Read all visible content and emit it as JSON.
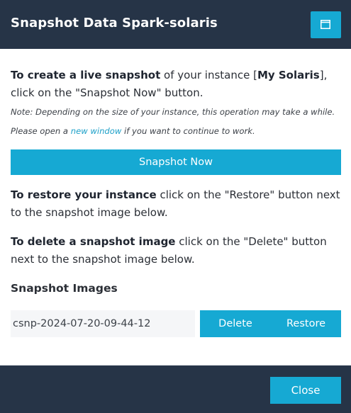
{
  "header": {
    "title": "Snapshot Data Spark-solaris",
    "window_icon": "window-icon"
  },
  "intro": {
    "bold1": "To create a live snapshot",
    "text1": " of your instance [",
    "instance_name": "My Solaris",
    "text2": "], click on the \"Snapshot Now\" button."
  },
  "note": {
    "before": "Note: Depending on the size of your instance, this operation may take a while. Please open a ",
    "link": "new window",
    "after": " if you want to continue to work."
  },
  "snapshot_button_label": "Snapshot Now",
  "restore_info": {
    "bold": "To restore your instance",
    "text": " click on the \"Restore\" button next to the snapshot image below."
  },
  "delete_info": {
    "bold": "To delete a snapshot image",
    "text": " click on the \"Delete\" button next to the snapshot image below."
  },
  "images_title": "Snapshot Images",
  "images": [
    {
      "name": "csnp-2024-07-20-09-44-12",
      "delete_label": "Delete",
      "restore_label": "Restore"
    }
  ],
  "footer": {
    "close_label": "Close"
  },
  "colors": {
    "accent": "#16a9d3",
    "header_bg": "#263447"
  }
}
